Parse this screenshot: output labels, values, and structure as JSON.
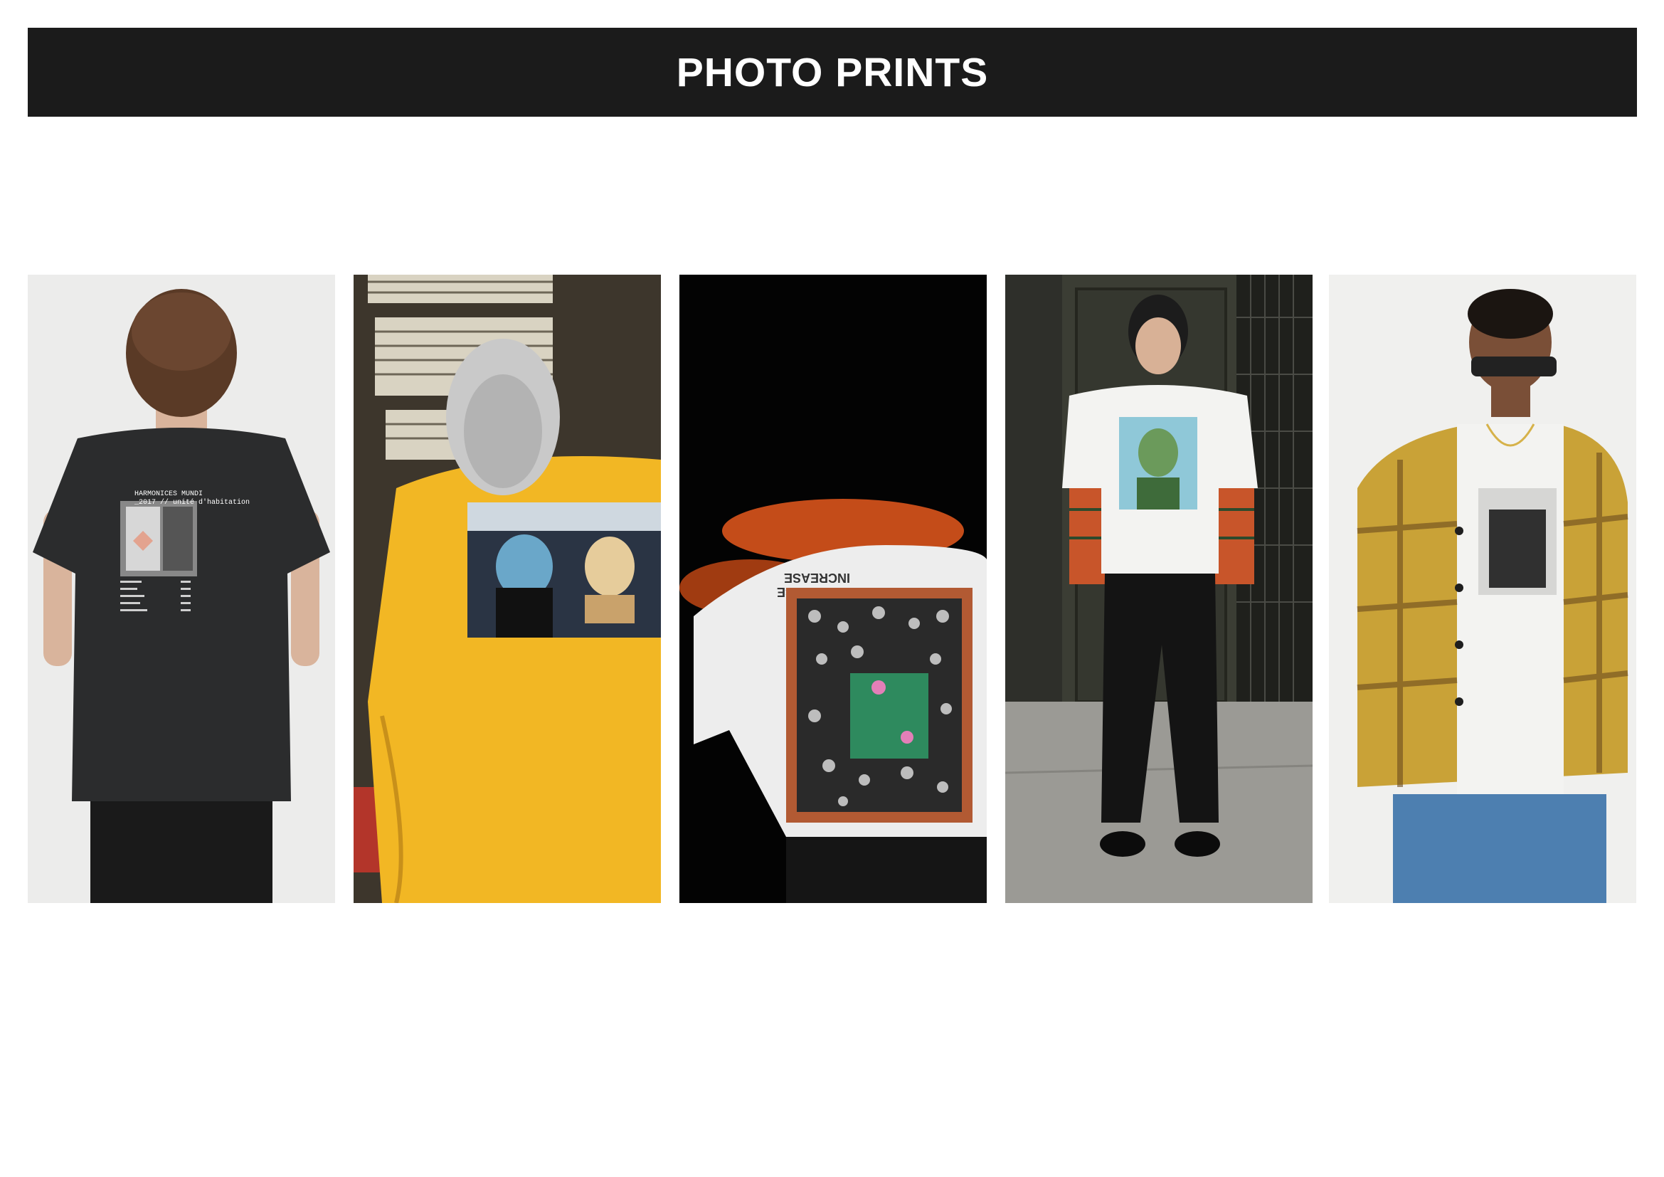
{
  "header": {
    "title": "PHOTO PRINTS"
  },
  "photos": [
    {
      "subject": "black-tee-back-view",
      "print_text": {
        "line1": "HARMONICES MUNDI",
        "line2": "_2017 // unité d'habitation"
      }
    },
    {
      "subject": "yellow-coach-jacket-back-view"
    },
    {
      "subject": "white-tee-crowd-print",
      "print_text": {
        "line1": "INCREASE",
        "line2": "THE PEACE"
      }
    },
    {
      "subject": "white-tee-portrait-print-street"
    },
    {
      "subject": "mustard-plaid-cardigan"
    }
  ],
  "colors": {
    "header_bg": "#1b1b1b",
    "header_text": "#ffffff",
    "page_bg": "#ffffff"
  }
}
